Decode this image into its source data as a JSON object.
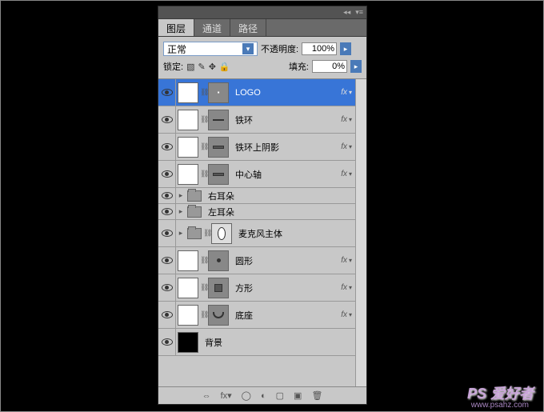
{
  "tabs": {
    "layers": "图层",
    "channels": "通道",
    "paths": "路径"
  },
  "controls": {
    "blend_mode": "正常",
    "opacity_label": "不透明度:",
    "opacity_value": "100%",
    "lock_label": "锁定:",
    "fill_label": "填充:",
    "fill_value": "0%"
  },
  "layers": [
    {
      "name": "LOGO",
      "type": "masked",
      "selected": true,
      "fx": true
    },
    {
      "name": "铁环",
      "type": "masked-shape",
      "shape": "line",
      "fx": true
    },
    {
      "name": "铁环上阴影",
      "type": "masked-shape",
      "shape": "rect",
      "fx": true
    },
    {
      "name": "中心轴",
      "type": "masked-shape",
      "shape": "rect",
      "fx": true
    },
    {
      "name": "右耳朵",
      "type": "folder"
    },
    {
      "name": "左耳朵",
      "type": "folder"
    },
    {
      "name": "麦克风主体",
      "type": "folder-vec",
      "shape": "oval"
    },
    {
      "name": "圆形",
      "type": "masked-shape",
      "shape": "circ",
      "fx": true
    },
    {
      "name": "方形",
      "type": "masked-shape",
      "shape": "sq",
      "fx": true
    },
    {
      "name": "底座",
      "type": "masked-shape",
      "shape": "arc",
      "fx": true
    },
    {
      "name": "背景",
      "type": "bg"
    }
  ],
  "fx_label": "fx",
  "watermark": {
    "main": "PS 爱好者",
    "sub": "www.psahz.com"
  }
}
